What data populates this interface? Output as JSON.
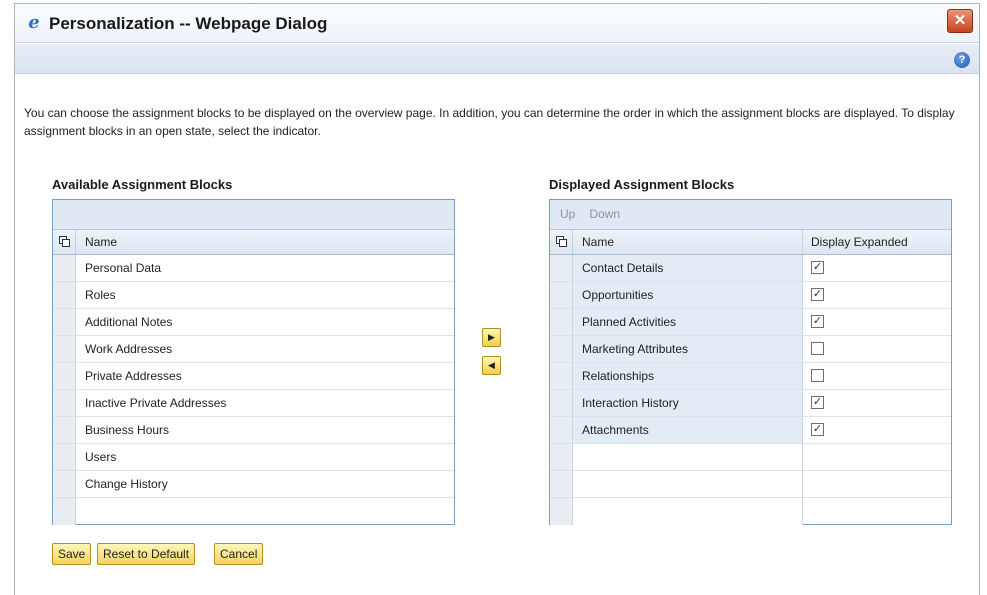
{
  "window": {
    "title": "Personalization -- Webpage Dialog",
    "close_glyph": "✕",
    "help_glyph": "?"
  },
  "intro": "You can choose the assignment blocks to be displayed on the overview page. In addition, you can determine the order in which the assignment blocks are displayed. To display assignment blocks in an open state, select the indicator.",
  "available": {
    "title": "Available Assignment Blocks",
    "column_name": "Name",
    "items": [
      "Personal Data",
      "Roles",
      "Additional Notes",
      "Work Addresses",
      "Private Addresses",
      "Inactive Private Addresses",
      "Business Hours",
      "Users",
      "Change History"
    ]
  },
  "displayed": {
    "title": "Displayed Assignment Blocks",
    "up_label": "Up",
    "down_label": "Down",
    "column_name": "Name",
    "column_expanded": "Display Expanded",
    "items": [
      {
        "name": "Contact Details",
        "expanded": true
      },
      {
        "name": "Opportunities",
        "expanded": true
      },
      {
        "name": "Planned Activities",
        "expanded": true
      },
      {
        "name": "Marketing Attributes",
        "expanded": false
      },
      {
        "name": "Relationships",
        "expanded": false
      },
      {
        "name": "Interaction History",
        "expanded": true
      },
      {
        "name": "Attachments",
        "expanded": true
      }
    ]
  },
  "move_buttons": {
    "add_glyph": "▶",
    "remove_glyph": "◀"
  },
  "footer": {
    "save": "Save",
    "reset": "Reset to Default",
    "cancel": "Cancel"
  },
  "icons": {
    "app": "ie-icon",
    "close": "close-icon",
    "help": "help-icon",
    "copy": "copy-icon"
  },
  "colors": {
    "button_accent": "#efd14f",
    "table_header": "#dde6f1",
    "title_bar": "#eef2f8"
  }
}
